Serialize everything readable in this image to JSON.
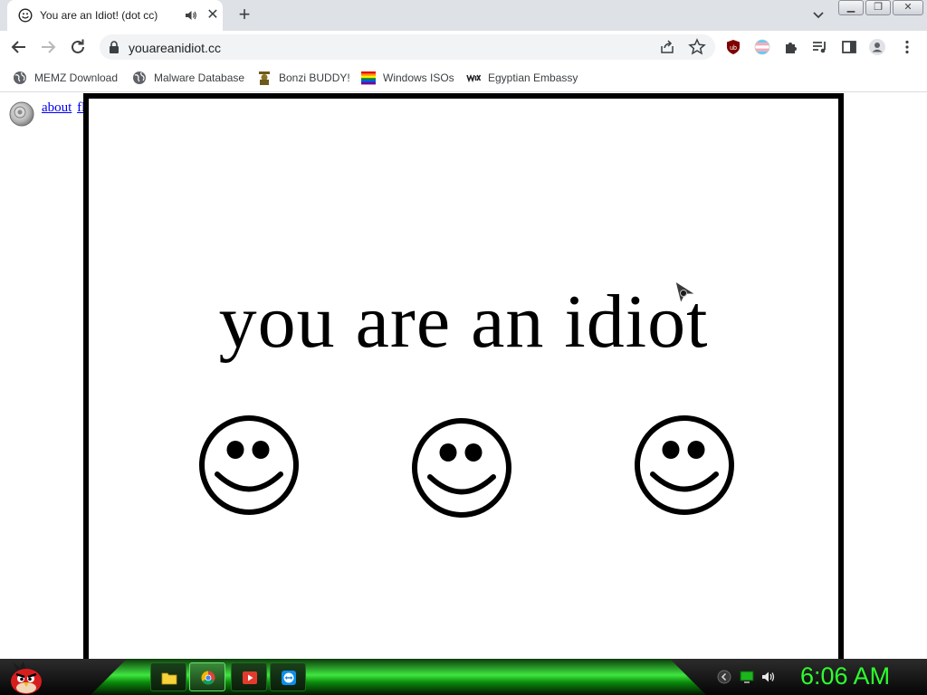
{
  "browser": {
    "tab": {
      "title": "You are an Idiot! (dot cc)"
    },
    "address_bar": {
      "url": "youareanidiot.cc"
    }
  },
  "bookmarks": [
    {
      "label": "MEMZ Download",
      "icon": "globe-icon"
    },
    {
      "label": "Malware Database",
      "icon": "globe-icon"
    },
    {
      "label": "Bonzi BUDDY!",
      "icon": "bonzi-icon"
    },
    {
      "label": "Windows ISOs",
      "icon": "rainbow-flag-icon"
    },
    {
      "label": "Egyptian Embassy",
      "icon": "wix-icon"
    }
  ],
  "page": {
    "links": [
      "about",
      "flash"
    ],
    "message": "you are an idiot",
    "smiley_count": 3
  },
  "taskbar": {
    "clock": "6:06 AM",
    "apps": [
      "file-explorer-icon",
      "chrome-icon",
      "media-player-icon",
      "teamviewer-icon"
    ]
  },
  "colors": {
    "tabstrip": "#dee1e6",
    "link": "#0000ee",
    "clock": "#2dff2d",
    "taskbar_glow": "#3fe63f"
  }
}
